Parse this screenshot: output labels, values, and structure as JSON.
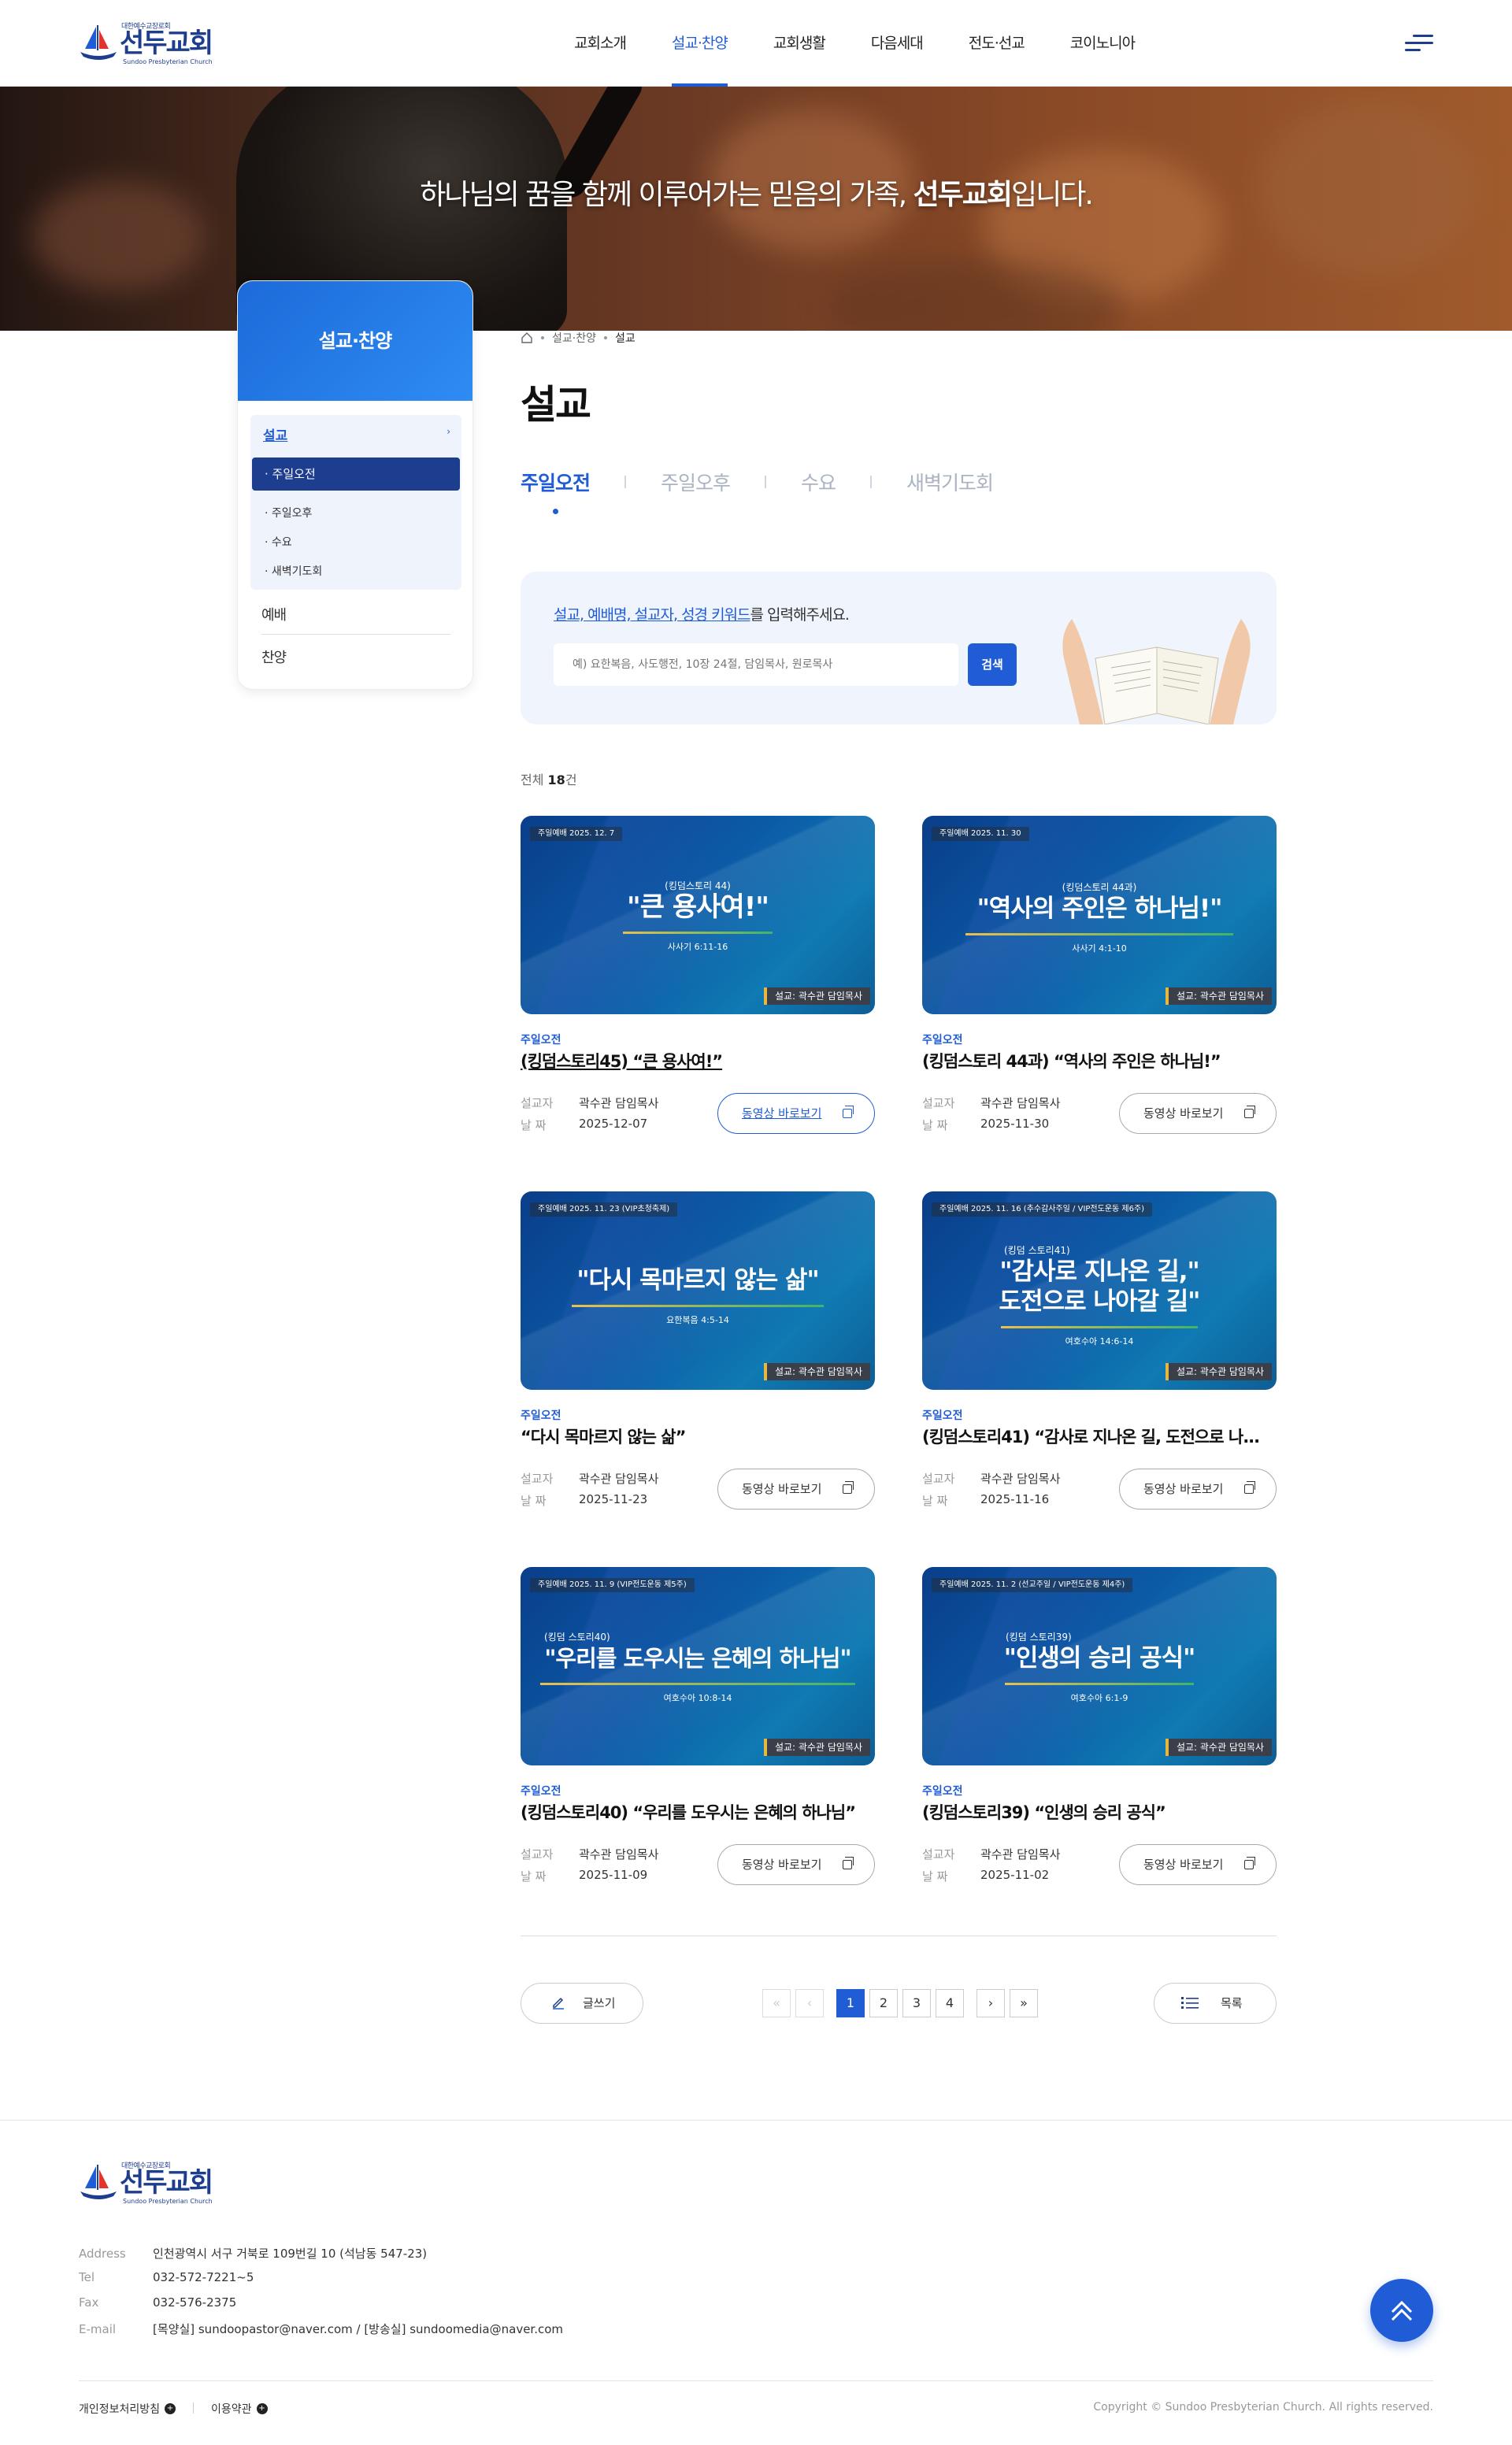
{
  "header": {
    "logo_sub": "대한예수교장로회",
    "logo_name": "선두교회",
    "logo_eng": "Sundoo Presbyterian Church",
    "nav": [
      "교회소개",
      "설교·찬양",
      "교회생활",
      "다음세대",
      "전도·선교",
      "코이노니아"
    ],
    "nav_active": 1
  },
  "hero": {
    "slogan_pre": "하나님의 꿈을 함께 이루어가는 믿음의 가족, ",
    "slogan_bold": "선두교회",
    "slogan_post": "입니다."
  },
  "lnb": {
    "title": "설교·찬양",
    "current": "설교",
    "current_arrow": "›",
    "active_sub": "· 주일오전",
    "subs": [
      "· 주일오후",
      "· 수요",
      "· 새벽기도회"
    ],
    "others": [
      "예배",
      "찬양"
    ]
  },
  "breadcrumb": {
    "home": "home",
    "l1": "설교·찬양",
    "l2": "설교"
  },
  "page_title": "설교",
  "tabs": [
    {
      "label": "주일오전",
      "active": true
    },
    {
      "label": "주일오후"
    },
    {
      "label": "수요"
    },
    {
      "label": "새벽기도회"
    }
  ],
  "search": {
    "guide_keyword": "설교, 예배명, 설교자, 성경 키워드",
    "guide_rest": "를 입력해주세요.",
    "placeholder": "예) 요한복음, 사도행전, 10장 24절, 담임목사, 원로목사",
    "button": "검색"
  },
  "total": {
    "prefix": "전체",
    "count": "18",
    "suffix": "건"
  },
  "labels": {
    "preacher": "설교자",
    "date": "날    짜",
    "video_btn": "동영상 바로보기",
    "thumb_pastor": "설교: 곽수관 담임목사"
  },
  "posts": [
    {
      "thumb_date": "주일예배 2025. 12. 7",
      "thumb_small": "(킹덤스토리 44)",
      "thumb_big": "\"큰 용사여!\"",
      "thumb_verse": "사사기 6:11-16",
      "category": "주일오전",
      "title": "(킹덤스토리45) “큰 용사여!”",
      "preacher": "곽수관 담임목사",
      "date": "2025-12-07",
      "hover": true
    },
    {
      "thumb_date": "주일예배 2025. 11. 30",
      "thumb_small": "(킹덤스토리 44과)",
      "thumb_big": "\"역사의 주인은 하나님!\"",
      "thumb_verse": "사사기 4:1-10",
      "category": "주일오전",
      "title": "(킹덤스토리 44과) “역사의 주인은 하나님!”",
      "preacher": "곽수관 담임목사",
      "date": "2025-11-30"
    },
    {
      "thumb_date": "주일예배 2025. 11. 23 (VIP초청축제)",
      "thumb_small": "",
      "thumb_big": "\"다시 목마르지 않는 삶\"",
      "thumb_verse": "요한복음 4:5-14",
      "category": "주일오전",
      "title": "“다시 목마르지 않는 삶”",
      "preacher": "곽수관 담임목사",
      "date": "2025-11-23"
    },
    {
      "thumb_date": "주일예배 2025. 11. 16 (추수감사주일 / VIP전도운동 제6주)",
      "thumb_small": "(킹덤 스토리41)",
      "thumb_big": "\"감사로 지나온 길,\"",
      "thumb_big2": "도전으로 나아갈 길\"",
      "thumb_verse": "여호수아 14:6-14",
      "category": "주일오전",
      "title": "(킹덤스토리41) “감사로 지나온 길, 도전으로 나...",
      "preacher": "곽수관 담임목사",
      "date": "2025-11-16"
    },
    {
      "thumb_date": "주일예배 2025. 11. 9 (VIP전도운동 제5주)",
      "thumb_small": "(킹덤 스토리40)",
      "thumb_big": "\"우리를 도우시는 은혜의 하나님\"",
      "thumb_verse": "여호수아 10:8-14",
      "category": "주일오전",
      "title": "(킹덤스토리40) “우리를 도우시는 은혜의 하나님”",
      "preacher": "곽수관 담임목사",
      "date": "2025-11-09"
    },
    {
      "thumb_date": "주일예배 2025. 11. 2 (선교주일 / VIP전도운동 제4주)",
      "thumb_small": "(킹덤 스토리39)",
      "thumb_big": "\"인생의 승리 공식\"",
      "thumb_verse": "여호수아 6:1-9",
      "category": "주일오전",
      "title": "(킹덤스토리39) “인생의 승리 공식”",
      "preacher": "곽수관 담임목사",
      "date": "2025-11-02"
    }
  ],
  "pager": {
    "first": "«",
    "prev": "‹",
    "pages": [
      "1",
      "2",
      "3",
      "4"
    ],
    "current": "1",
    "next": "›",
    "last": "»"
  },
  "buttons": {
    "write": "글쓰기",
    "list": "목록"
  },
  "footer": {
    "logo_sub": "대한예수교장로회",
    "logo_name": "선두교회",
    "logo_eng": "Sundoo Presbyterian Church",
    "info": [
      {
        "k": "Address",
        "v": "인천광역시 서구 거북로 109번길 10 (석남동 547-23)"
      },
      {
        "k": "Tel",
        "v": "032-572-7221~5"
      },
      {
        "k": "Fax",
        "v": "032-576-2375"
      },
      {
        "k": "E-mail",
        "v": "[목양실] sundoopastor@naver.com / [방송실] sundoomedia@naver.com"
      }
    ],
    "privacy": "개인정보처리방침",
    "terms": "이용약관",
    "copyright": "Copyright © Sundoo Presbyterian Church. All rights reserved."
  },
  "colors": {
    "accent": "#1f5cd6",
    "navy": "#1d3d8f"
  }
}
